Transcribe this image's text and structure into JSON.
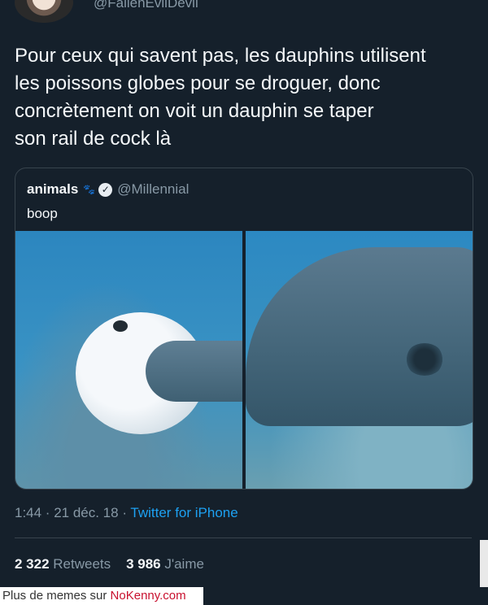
{
  "header": {
    "handle": "@FallenEvilDevil",
    "avatar_icon": "user-avatar"
  },
  "tweet": {
    "text": "Pour ceux qui savent pas, les dauphins utilisent\nles poissons globes pour se droguer, donc\nconcrètement on voit un dauphin se taper\nson rail de cock là"
  },
  "quoted_tweet": {
    "name": "animals",
    "emoji_icon": "paw-prints-icon",
    "verified_icon": "verified-badge-icon",
    "handle": "@Millennial",
    "text": "boop",
    "images": [
      "pufferfish-dolphin-left",
      "dolphin-closeup-right"
    ]
  },
  "meta": {
    "time": "1:44 · 21 déc. 18 · ",
    "source": "Twitter for iPhone"
  },
  "stats": {
    "retweets_count": "2 322",
    "retweets_label": "Retweets",
    "likes_count": "3 986",
    "likes_label": "J'aime"
  },
  "footer": {
    "text": "Plus de memes sur ",
    "link": "NoKenny.com"
  },
  "colors": {
    "background": "#15202b",
    "link": "#1da1f2",
    "secondary_text": "#8899a6"
  }
}
